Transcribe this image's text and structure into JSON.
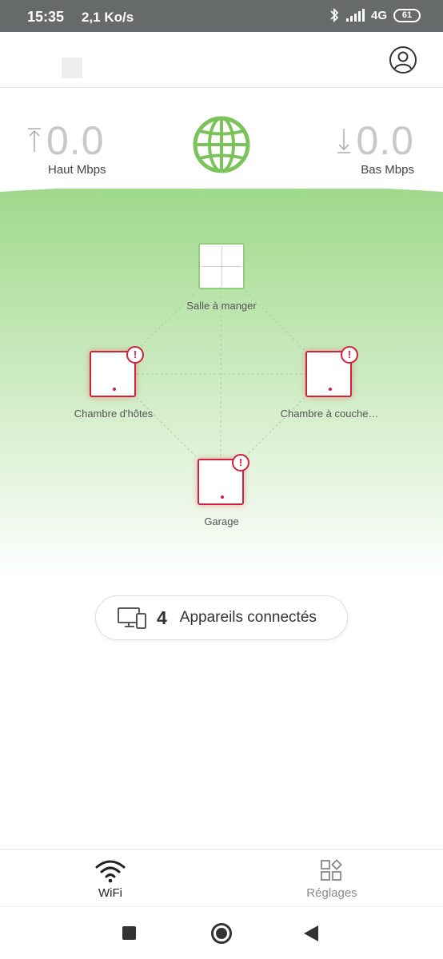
{
  "status_bar": {
    "time": "15:35",
    "speed": "2,1 Ko/s",
    "network": "4G",
    "battery": "61"
  },
  "header": {
    "account_icon": "user-circle-icon"
  },
  "speed": {
    "upload_value": "0.0",
    "upload_label": "Haut Mbps",
    "download_value": "0.0",
    "download_label": "Bas Mbps"
  },
  "network_map": {
    "main_node": {
      "label": "Salle à manger",
      "status": "online"
    },
    "satellites": [
      {
        "label": "Chambre d'hôtes",
        "alert": "!"
      },
      {
        "label": "Chambre à couche…",
        "alert": "!"
      },
      {
        "label": "Garage",
        "alert": "!"
      }
    ]
  },
  "devices": {
    "count": "4",
    "label": "Appareils connectés"
  },
  "bottom_nav": {
    "items": [
      {
        "label": "WiFi",
        "icon": "wifi-icon",
        "active": true
      },
      {
        "label": "Réglages",
        "icon": "settings-grid-icon",
        "active": false
      }
    ]
  },
  "colors": {
    "accent_green": "#8fcd77",
    "alert_red": "#d3213c",
    "status_bar": "#666a6b"
  }
}
